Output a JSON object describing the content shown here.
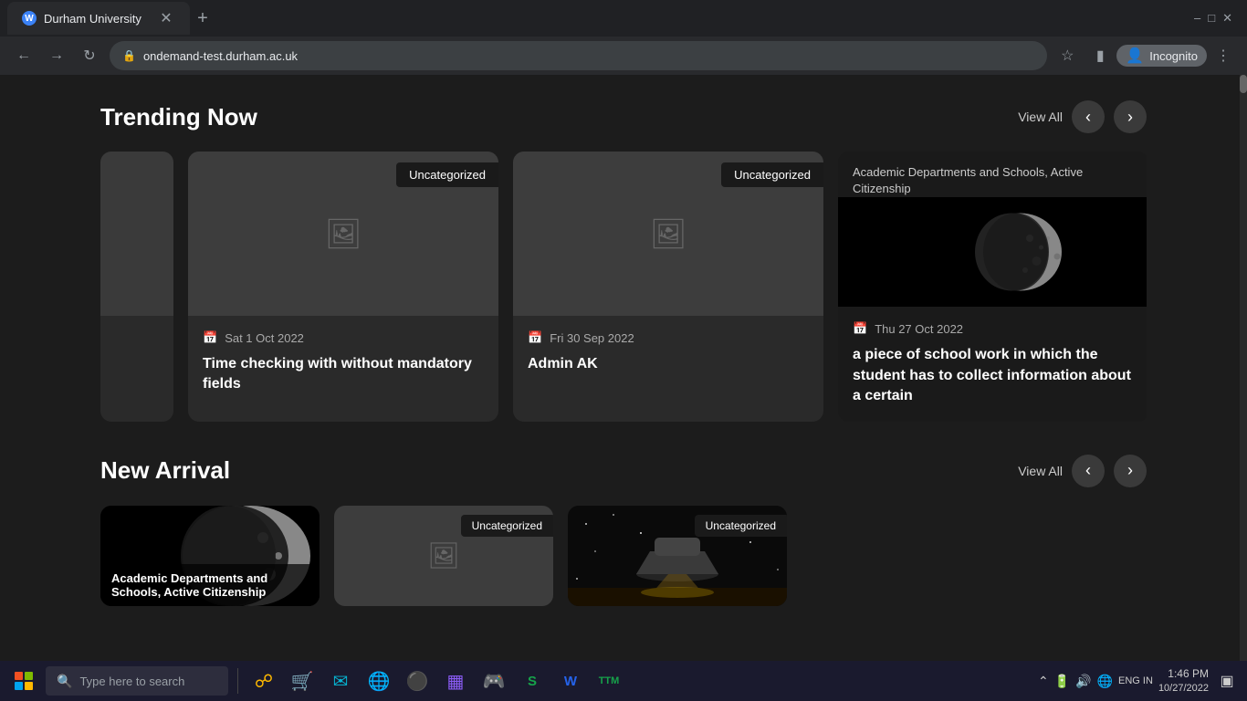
{
  "browser": {
    "tab_title": "Durham University",
    "url": "ondemand-test.durham.ac.uk",
    "incognito_label": "Incognito"
  },
  "trending": {
    "title": "Trending Now",
    "view_all": "View All",
    "cards": [
      {
        "category": "Uncategorized",
        "date": "Sat 1 Oct 2022",
        "title": "Time checking with without mandatory fields",
        "has_image": false
      },
      {
        "category": "Uncategorized",
        "date": "Fri 30 Sep 2022",
        "title": "Admin AK",
        "has_image": false
      },
      {
        "category": "Academic Departments and Schools, Active Citizenship",
        "date": "Thu 27 Oct 2022",
        "title": "a piece of school work in which the student has to collect information about a certain",
        "has_image": true
      }
    ]
  },
  "new_arrival": {
    "title": "New Arrival",
    "view_all": "View All",
    "cards": [
      {
        "title": "Academic Departments and Schools, Active Citizenship",
        "has_moon": true
      },
      {
        "category": "Uncategorized",
        "has_image": false
      },
      {
        "category": "Uncategorized",
        "has_space_image": true
      }
    ]
  },
  "taskbar": {
    "search_placeholder": "Type here to search",
    "time": "1:46 PM",
    "date": "10/27/2022",
    "lang": "ENG IN"
  }
}
